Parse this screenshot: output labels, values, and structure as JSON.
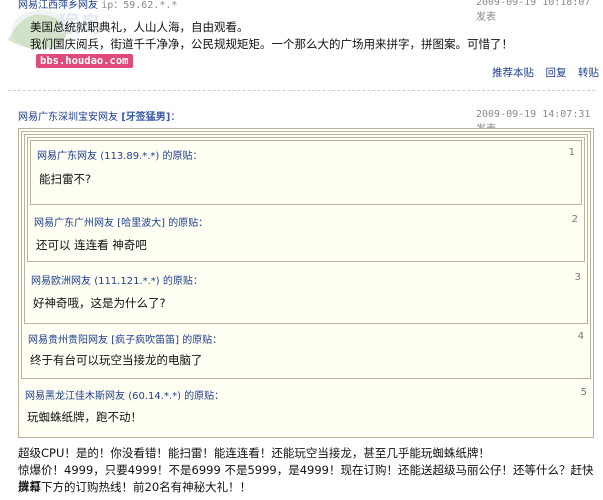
{
  "post1": {
    "poster_partial": "网易江西萍乡网友",
    "ip_partial": "ip：59.62.*.*",
    "datetime": "2009-09-19 10:18:07",
    "action": "发表",
    "line1": "美国总统就职典礼，人山人海，自由观看。",
    "line2": "我们国庆阅兵，街道千千净净，公民规规矩矩。一个那么大的广场用来拼字，拼图案。可惜了！",
    "links": [
      "推荐本贴",
      "回复",
      "转贴"
    ]
  },
  "watermark": {
    "site": "bbs.houdao.com"
  },
  "post2": {
    "poster": "网易广东深圳宝安网友",
    "nick": "[牙签猛男]",
    "colon": "：",
    "datetime": "2009-09-19 14:07:31",
    "action": "发表",
    "quotes": [
      {
        "num": "1",
        "author": "网易广东网友",
        "ip": "(113.89.*.*)",
        "suffix": "的原贴：",
        "text": "能扫雷不?"
      },
      {
        "num": "2",
        "author": "网易广东广州网友",
        "nick": "[哈里波大]",
        "suffix": "的原贴：",
        "text": "还可以 连连看  神奇吧"
      },
      {
        "num": "3",
        "author": "网易欧洲网友",
        "ip": "(111.121.*.*)",
        "suffix": "的原贴：",
        "text": "好神奇哦，这是为什么了?"
      },
      {
        "num": "4",
        "author": "网易贵州贵阳网友",
        "nick": "[疯子疯吹笛笛]",
        "suffix": "的原贴：",
        "text": "终于有台可以玩空当接龙的电脑了"
      },
      {
        "num": "5",
        "author": "网易黑龙江佳木斯网友",
        "ip": "(60.14.*.*)",
        "suffix": "的原贴：",
        "text": "玩蜘蛛纸牌，跑不动！"
      }
    ],
    "body_line1": "超级CPU！是的！你没看错！能扫雷！能连连看！还能玩空当接龙，甚至几乎能玩蜘蛛纸牌！",
    "body_line2": "惊爆价！4999，只要4999！不是6999 不是5999，是4999！现在订购！还能送超级马丽公仔！还等什么？赶快拨打",
    "body_line3": "屏幕下方的订购热线！前20名有神秘大礼！！"
  }
}
